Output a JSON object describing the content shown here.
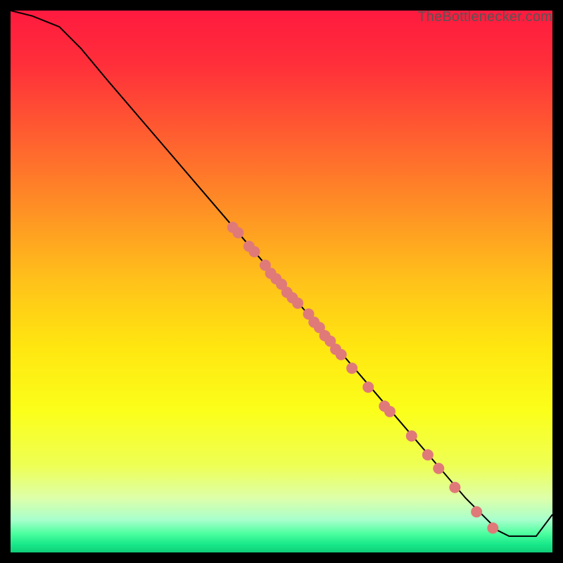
{
  "attribution": "TheBottlenecker.com",
  "gradient_stops": [
    {
      "offset": 0.0,
      "color": "#ff1a3f"
    },
    {
      "offset": 0.1,
      "color": "#ff2f3a"
    },
    {
      "offset": 0.22,
      "color": "#ff5a31"
    },
    {
      "offset": 0.35,
      "color": "#ff8a26"
    },
    {
      "offset": 0.5,
      "color": "#ffc21a"
    },
    {
      "offset": 0.62,
      "color": "#ffe610"
    },
    {
      "offset": 0.74,
      "color": "#fbff1a"
    },
    {
      "offset": 0.84,
      "color": "#eeff55"
    },
    {
      "offset": 0.9,
      "color": "#ddffaa"
    },
    {
      "offset": 0.94,
      "color": "#a8ffcc"
    },
    {
      "offset": 0.965,
      "color": "#4dff9f"
    },
    {
      "offset": 0.985,
      "color": "#18e88a"
    },
    {
      "offset": 1.0,
      "color": "#0fcf78"
    }
  ],
  "chart_data": {
    "type": "line",
    "x": [
      0,
      4,
      9,
      13,
      18,
      24,
      30,
      36,
      42,
      48,
      54,
      60,
      66,
      72,
      78,
      84,
      88,
      90,
      92,
      95,
      97,
      100
    ],
    "values": [
      100,
      99,
      97,
      93,
      87,
      80,
      73,
      66,
      59,
      52,
      45,
      38,
      31,
      24,
      17,
      10,
      6,
      4,
      3,
      3,
      3,
      7
    ],
    "xlim": [
      0,
      100
    ],
    "ylim": [
      0,
      100
    ],
    "marker_points": [
      {
        "x": 41,
        "y": 60
      },
      {
        "x": 42,
        "y": 59
      },
      {
        "x": 44,
        "y": 56.5
      },
      {
        "x": 45,
        "y": 55.5
      },
      {
        "x": 47,
        "y": 53
      },
      {
        "x": 48,
        "y": 51.5
      },
      {
        "x": 49,
        "y": 50.5
      },
      {
        "x": 50,
        "y": 49.5
      },
      {
        "x": 51,
        "y": 48
      },
      {
        "x": 52,
        "y": 47
      },
      {
        "x": 53,
        "y": 46
      },
      {
        "x": 55,
        "y": 44
      },
      {
        "x": 56,
        "y": 42.5
      },
      {
        "x": 57,
        "y": 41.5
      },
      {
        "x": 58,
        "y": 40
      },
      {
        "x": 59,
        "y": 39
      },
      {
        "x": 60,
        "y": 37.5
      },
      {
        "x": 61,
        "y": 36.5
      },
      {
        "x": 63,
        "y": 34
      },
      {
        "x": 66,
        "y": 30.5
      },
      {
        "x": 69,
        "y": 27
      },
      {
        "x": 70,
        "y": 26
      },
      {
        "x": 74,
        "y": 21.5
      },
      {
        "x": 77,
        "y": 18
      },
      {
        "x": 79,
        "y": 15.5
      },
      {
        "x": 82,
        "y": 12
      },
      {
        "x": 86,
        "y": 7.5
      },
      {
        "x": 89,
        "y": 4.5
      }
    ],
    "marker_color": "#e07a78",
    "line_color": "#000000"
  }
}
